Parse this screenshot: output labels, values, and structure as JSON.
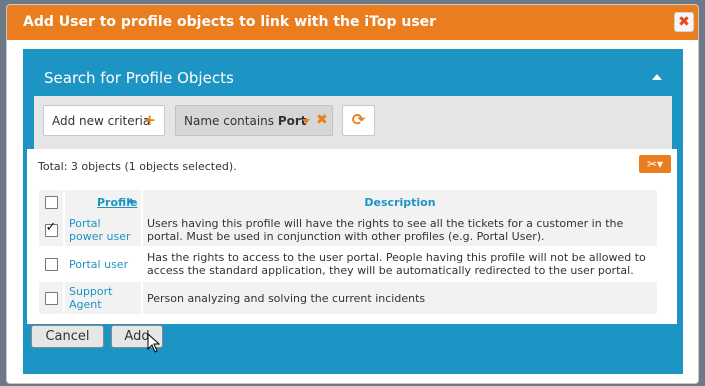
{
  "dialog": {
    "title": "Add User to profile objects to link with the iTop user",
    "close_glyph": "✖"
  },
  "search": {
    "title": "Search for Profile Objects",
    "add_criteria_label": "Add new criteria",
    "add_criteria_icon": "plus-icon",
    "criterion_prefix": "Name contains",
    "criterion_value": "Port",
    "criterion_remove_glyph": "✖",
    "refresh_glyph": "⟳"
  },
  "results": {
    "total_text": "Total: 3 objects (1 objects selected).",
    "tools_glyph": "✂▾",
    "columns": {
      "profile": "Profile",
      "description": "Description"
    },
    "rows": [
      {
        "profile": "Portal power user",
        "description": "Users having this profile will have the rights to see all the tickets for a customer in the portal. Must be used in conjunction with other profiles (e.g. Portal User).",
        "checked": true
      },
      {
        "profile": "Portal user",
        "description": "Has the rights to access to the user portal. People having this profile will not be allowed to access the standard application, they will be automatically redirected to the user portal.",
        "checked": false
      },
      {
        "profile": "Support Agent",
        "description": "Person analyzing and solving the current incidents",
        "checked": false
      }
    ]
  },
  "buttons": {
    "cancel": "Cancel",
    "add": "Add"
  },
  "colors": {
    "accent": "#ea7d1e",
    "primary": "#1c94c4"
  }
}
